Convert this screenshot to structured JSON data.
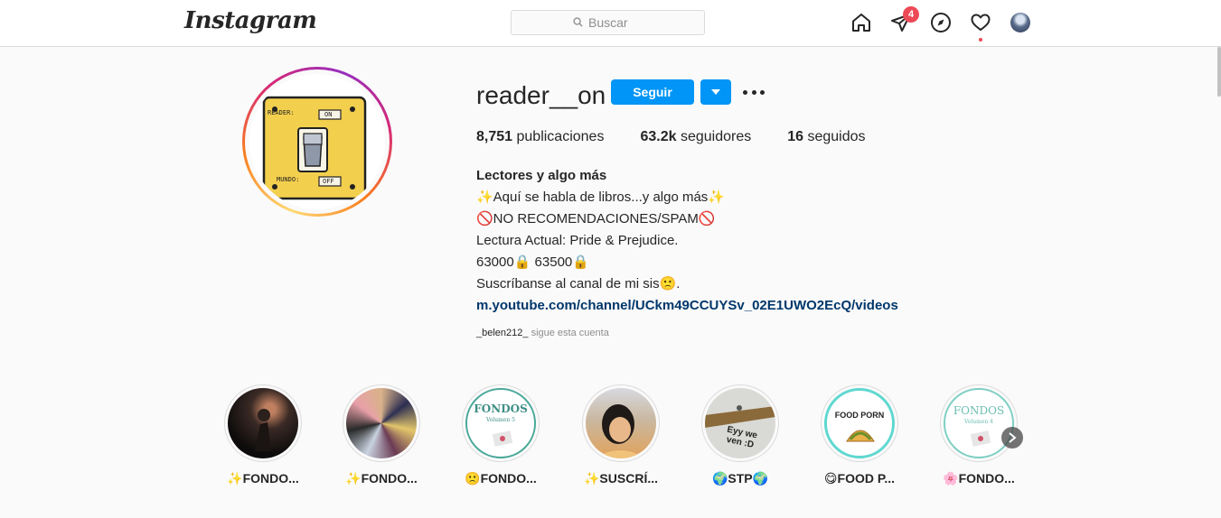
{
  "app": {
    "logo_text": "Instagram"
  },
  "search": {
    "placeholder": "Buscar"
  },
  "nav": {
    "icons": [
      "home-icon",
      "direct-messages-icon",
      "explore-compass-icon",
      "activity-heart-icon",
      "profile-avatar"
    ],
    "direct_badge": "4"
  },
  "profile": {
    "username": "reader__on",
    "follow_label": "Seguir",
    "stats": [
      {
        "value": "8,751",
        "label": "publicaciones"
      },
      {
        "value": "63.2k",
        "label": "seguidores"
      },
      {
        "value": "16",
        "label": "seguidos"
      }
    ],
    "avatar": {
      "label_top": "READER:",
      "tag_top": "ON",
      "label_bottom": "MUNDO:",
      "tag_bottom": "OFF"
    },
    "bio": {
      "name": "Lectores y algo más",
      "line1": "✨Aquí se habla de libros...y algo más✨",
      "line2": "🚫NO RECOMENDACIONES/SPAM🚫",
      "line3": "Lectura Actual: Pride & Prejudice.",
      "line4": "63000🔒 63500🔒",
      "line5": "Suscríbanse al canal de mi sis🙁.",
      "link": "m.youtube.com/channel/UCkm49CCUYSv_02E1UWO2EcQ/videos"
    },
    "followed_by": {
      "user": "_belen212_",
      "text": "sigue esta cuenta"
    }
  },
  "highlights": [
    {
      "label": "✨FONDO..."
    },
    {
      "label": "✨FONDO..."
    },
    {
      "label": "🙁FONDO...",
      "cover_title": "FONDOS",
      "cover_sub": "Volumen 5"
    },
    {
      "label": "✨SUSCRÍ..."
    },
    {
      "label": "🌍STP🌍",
      "cover_text": "Eyy we ven :D"
    },
    {
      "label": "😋FOOD P...",
      "cover_title": "FOOD PORN"
    },
    {
      "label": "🌸FONDO...",
      "cover_title": "FONDOS",
      "cover_sub": "Volumen 4"
    }
  ],
  "colors": {
    "accent": "#0095f6",
    "badge": "#ed4956",
    "link": "#00376b"
  }
}
